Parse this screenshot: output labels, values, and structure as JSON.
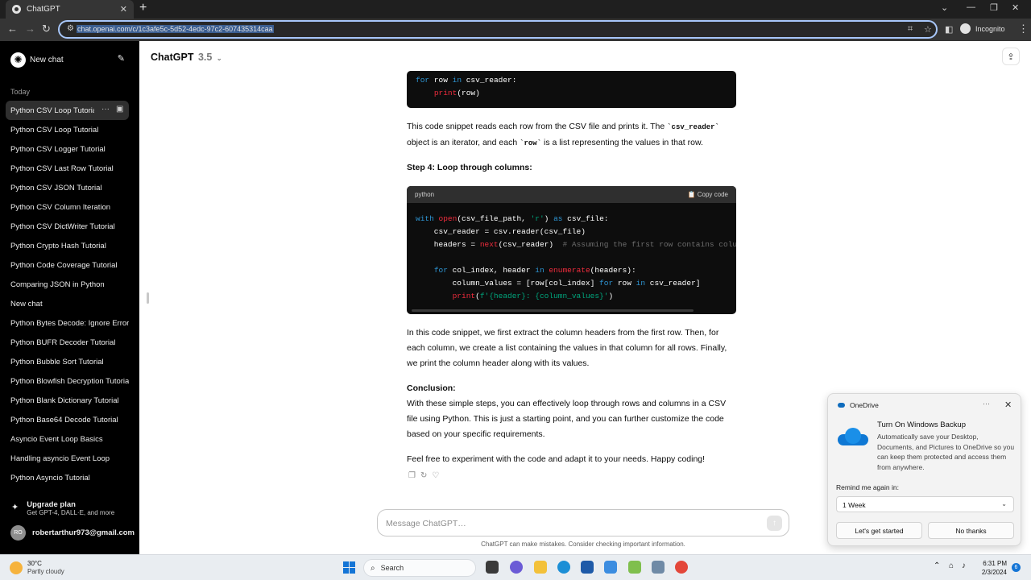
{
  "browser": {
    "tab_title": "ChatGPT",
    "tab_close": "✕",
    "new_tab": "+",
    "url": "chat.openai.com/c/1c3afe5c-5d52-4edc-97c2-607435314caa",
    "incognito_label": "Incognito"
  },
  "sidebar": {
    "new_chat": "New chat",
    "section_today": "Today",
    "items": [
      "Python CSV Loop Tutorial",
      "Python CSV Loop Tutorial",
      "Python CSV Logger Tutorial",
      "Python CSV Last Row Tutorial",
      "Python CSV JSON Tutorial",
      "Python CSV Column Iteration",
      "Python CSV DictWriter Tutorial",
      "Python Crypto Hash Tutorial",
      "Python Code Coverage Tutorial",
      "Comparing JSON in Python",
      "New chat",
      "Python Bytes Decode: Ignore Errors",
      "Python BUFR Decoder Tutorial",
      "Python Bubble Sort Tutorial",
      "Python Blowfish Decryption Tutorial",
      "Python Blank Dictionary Tutorial",
      "Python Base64 Decode Tutorial",
      "Asyncio Event Loop Basics",
      "Handling asyncio Event Loop",
      "Python Asyncio Tutorial"
    ],
    "upgrade_title": "Upgrade plan",
    "upgrade_sub": "Get GPT-4, DALL·E, and more",
    "account_initials": "RO",
    "account_email": "robertarthur973@gmail.com"
  },
  "header": {
    "model": "ChatGPT",
    "version": "3.5"
  },
  "content": {
    "code1_lines": [
      "for row in csv_reader:",
      "    print(row)"
    ],
    "p1_a": "This code snippet reads each row from the CSV file and prints it. The ",
    "p1_code1": "`csv_reader`",
    "p1_b": " object is an iterator, and each ",
    "p1_code2": "`row`",
    "p1_c": " is a list representing the values in that row.",
    "step4": "Step 4: Loop through columns:",
    "code2_lang": "python",
    "copy_code": "Copy code",
    "p2": "In this code snippet, we first extract the column headers from the first row. Then, for each column, we create a list containing the values in that column for all rows. Finally, we print the column header along with its values.",
    "conclusion_title": "Conclusion:",
    "conclusion_text": "With these simple steps, you can effectively loop through rows and columns in a CSV file using Python. This is just a starting point, and you can further customize the code based on your specific requirements.",
    "closing": "Feel free to experiment with the code and adapt it to your needs. Happy coding!"
  },
  "composer": {
    "placeholder": "Message ChatGPT…",
    "disclaimer": "ChatGPT can make mistakes. Consider checking important information."
  },
  "toast": {
    "app": "OneDrive",
    "title": "Turn On Windows Backup",
    "body": "Automatically save your Desktop, Documents, and Pictures to OneDrive so you can keep them protected and access them from anywhere.",
    "remind_label": "Remind me again in:",
    "remind_value": "1 Week",
    "primary": "Let's get started",
    "secondary": "No thanks"
  },
  "taskbar": {
    "temp": "30°C",
    "weather": "Partly cloudy",
    "search": "Search",
    "time": "6:31 PM",
    "date": "2/3/2024",
    "notifications": "6"
  },
  "colors": {
    "sidebar_bg": "#000000",
    "code_bg": "#0d0d0d",
    "code_keyword": "#2e95d3",
    "code_function": "#f22c3d",
    "code_string": "#00a67d",
    "omnibox_focus": "#a8c7fa",
    "windows_blue": "#1475d6"
  }
}
